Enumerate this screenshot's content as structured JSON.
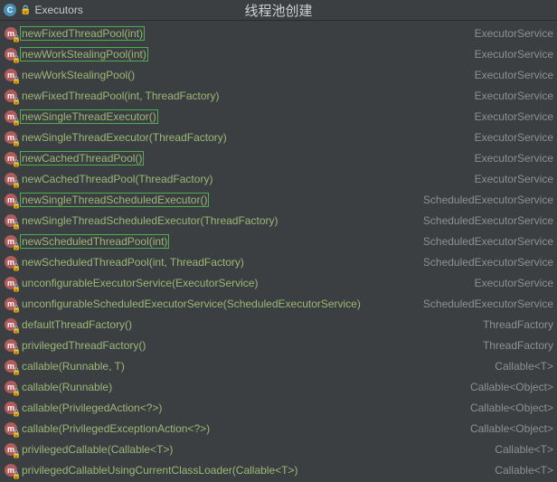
{
  "header": {
    "class_label": "C",
    "class_name": "Executors",
    "title": "线程池创建"
  },
  "method_icon_label": "m",
  "rows": [
    {
      "sig": "newFixedThreadPool(int)",
      "ret": "ExecutorService",
      "hl": true
    },
    {
      "sig": "newWorkStealingPool(int)",
      "ret": "ExecutorService",
      "hl": true
    },
    {
      "sig": "newWorkStealingPool()",
      "ret": "ExecutorService",
      "hl": false
    },
    {
      "sig": "newFixedThreadPool(int, ThreadFactory)",
      "ret": "ExecutorService",
      "hl": false
    },
    {
      "sig": "newSingleThreadExecutor()",
      "ret": "ExecutorService",
      "hl": true
    },
    {
      "sig": "newSingleThreadExecutor(ThreadFactory)",
      "ret": "ExecutorService",
      "hl": false
    },
    {
      "sig": "newCachedThreadPool()",
      "ret": "ExecutorService",
      "hl": true
    },
    {
      "sig": "newCachedThreadPool(ThreadFactory)",
      "ret": "ExecutorService",
      "hl": false
    },
    {
      "sig": "newSingleThreadScheduledExecutor()",
      "ret": "ScheduledExecutorService",
      "hl": true
    },
    {
      "sig": "newSingleThreadScheduledExecutor(ThreadFactory)",
      "ret": "ScheduledExecutorService",
      "hl": false
    },
    {
      "sig": "newScheduledThreadPool(int)",
      "ret": "ScheduledExecutorService",
      "hl": true
    },
    {
      "sig": "newScheduledThreadPool(int, ThreadFactory)",
      "ret": "ScheduledExecutorService",
      "hl": false
    },
    {
      "sig": "unconfigurableExecutorService(ExecutorService)",
      "ret": "ExecutorService",
      "hl": false
    },
    {
      "sig": "unconfigurableScheduledExecutorService(ScheduledExecutorService)",
      "ret": "ScheduledExecutorService",
      "hl": false
    },
    {
      "sig": "defaultThreadFactory()",
      "ret": "ThreadFactory",
      "hl": false
    },
    {
      "sig": "privilegedThreadFactory()",
      "ret": "ThreadFactory",
      "hl": false
    },
    {
      "sig": "callable(Runnable, T)",
      "ret": "Callable<T>",
      "hl": false
    },
    {
      "sig": "callable(Runnable)",
      "ret": "Callable<Object>",
      "hl": false
    },
    {
      "sig": "callable(PrivilegedAction<?>)",
      "ret": "Callable<Object>",
      "hl": false
    },
    {
      "sig": "callable(PrivilegedExceptionAction<?>)",
      "ret": "Callable<Object>",
      "hl": false
    },
    {
      "sig": "privilegedCallable(Callable<T>)",
      "ret": "Callable<T>",
      "hl": false
    },
    {
      "sig": "privilegedCallableUsingCurrentClassLoader(Callable<T>)",
      "ret": "Callable<T>",
      "hl": false
    }
  ]
}
